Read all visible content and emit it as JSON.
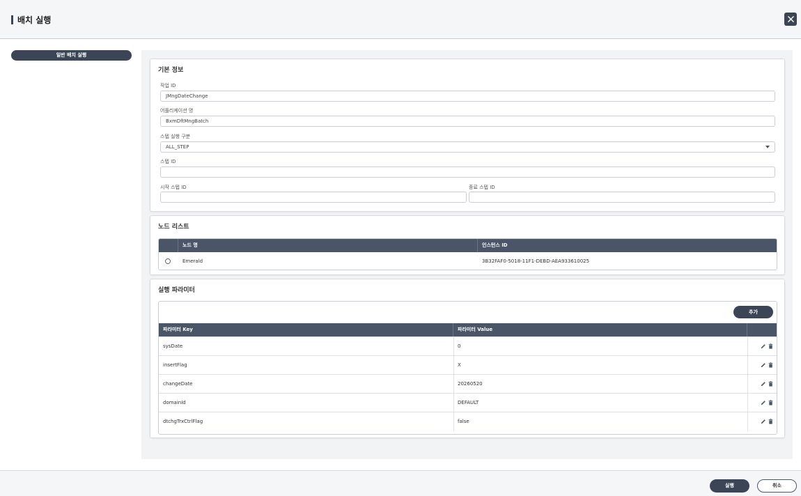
{
  "header": {
    "title": "배치 실행"
  },
  "nav": {
    "active_label": "일반 배치 실행"
  },
  "basic_info": {
    "title": "기본 정보",
    "job_id": {
      "label": "작업 ID",
      "value": "JMngDateChange"
    },
    "app_name": {
      "label": "어플리케이션 명",
      "value": "BxmDftMngBatch"
    },
    "step_exec_type": {
      "label": "스텝 실행 구분",
      "value": "ALL_STEP"
    },
    "step_id": {
      "label": "스텝 ID",
      "value": ""
    },
    "start_step_id": {
      "label": "시작 스텝 ID",
      "value": ""
    },
    "end_step_id": {
      "label": "종료 스텝 ID",
      "value": ""
    }
  },
  "node_list": {
    "title": "노드 리스트",
    "columns": [
      "노드 명",
      "인스턴스 ID"
    ],
    "rows": [
      {
        "node_name": "Emerald",
        "instance_id": "3B32FAF0-5018-11F1-DEBD-AEA933610025"
      }
    ]
  },
  "exec_params": {
    "title": "실행 파라미터",
    "add_label": "추가",
    "columns": [
      "파라미터 Key",
      "파라미터 Value"
    ],
    "rows": [
      {
        "key": "sysDate",
        "value": "0"
      },
      {
        "key": "insertFlag",
        "value": "X"
      },
      {
        "key": "changeDate",
        "value": "20260520"
      },
      {
        "key": "domainId",
        "value": "DEFAULT"
      },
      {
        "key": "dtchgTrxCtrlFlag",
        "value": "false"
      }
    ]
  },
  "footer": {
    "run_label": "실행",
    "cancel_label": "취소"
  },
  "icons": {
    "close": "close-icon",
    "edit": "pencil-icon",
    "delete": "trash-icon"
  },
  "colors": {
    "primary": "#3c4555",
    "table_header": "#4a5567"
  }
}
